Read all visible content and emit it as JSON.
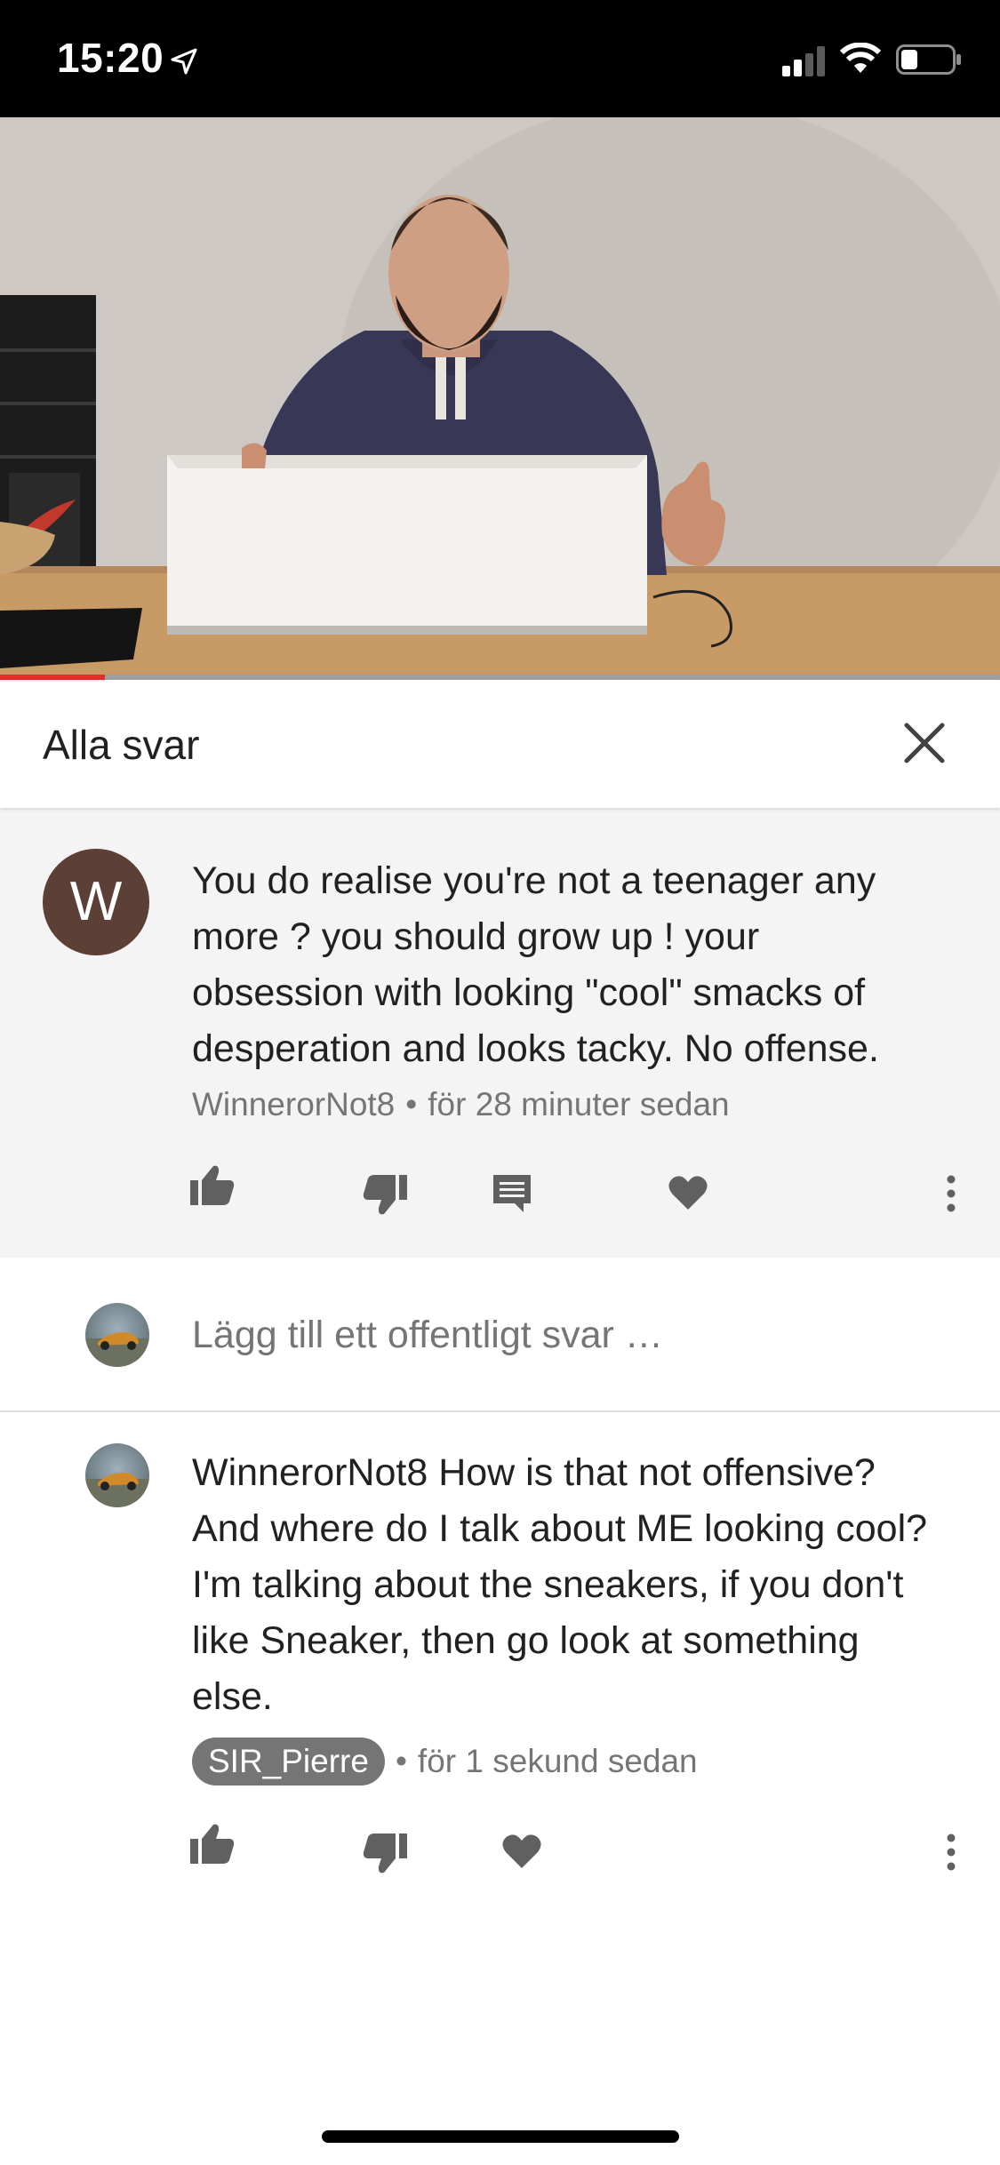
{
  "status_bar": {
    "time": "15:20"
  },
  "video": {
    "progress_percent": 10.5,
    "accent_color": "#e52d27"
  },
  "replies_header": {
    "title": "Alla svar"
  },
  "parent_comment": {
    "avatar_letter": "W",
    "avatar_color": "#5c3f35",
    "text_lines": [
      "You do realise you're not a teenager any",
      "more ? you should grow up ! your",
      "obsession with looking \"cool\" smacks of",
      "desperation and looks tacky. No offense."
    ],
    "author": "WinnerorNot8",
    "separator": "•",
    "time": "för 28 minuter sedan"
  },
  "reply_input": {
    "placeholder": "Lägg till ett offentligt svar …"
  },
  "reply": {
    "text_lines": [
      "WinnerorNot8 How is that not offensive?",
      "And where do I talk about ME looking cool?",
      "I'm talking about the sneakers, if you don't",
      "like Sneaker, then go look at something",
      "else."
    ],
    "author": "SIR_Pierre",
    "separator": "•",
    "time": "för 1 sekund sedan"
  },
  "icons": {
    "parent_actions": [
      "like-icon",
      "dislike-icon",
      "reply-icon",
      "heart-icon",
      "more-vert-icon"
    ],
    "reply_actions": [
      "like-icon",
      "dislike-icon",
      "heart-icon",
      "more-vert-icon"
    ]
  }
}
